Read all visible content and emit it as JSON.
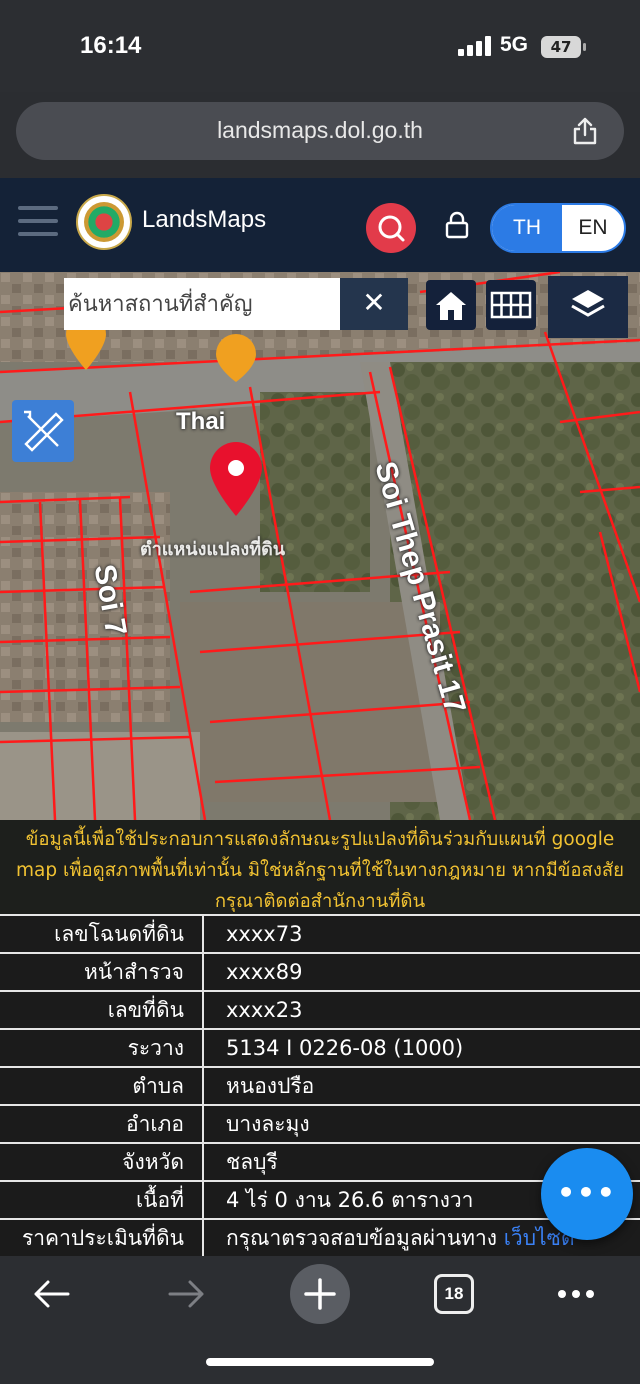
{
  "status_bar": {
    "time": "16:14",
    "network": "5G",
    "battery": "47"
  },
  "browser": {
    "url": "landsmaps.dol.go.th",
    "tab_count": "18"
  },
  "app": {
    "brand": "LandsMaps",
    "lang_th": "TH",
    "lang_en": "EN"
  },
  "map": {
    "search_placeholder": "ค้นหาสถานที่สำคัญ",
    "clear_label": "✕",
    "labels": {
      "thai": "Thai",
      "soi7": "Soi 7",
      "soi_thep": "Soi Thep Prasit 17",
      "parcel": "ตำแหน่งแปลงที่ดิน"
    }
  },
  "disclaimer": "ข้อมูลนี้เพื่อใช้ประกอบการแสดงลักษณะรูปแปลงที่ดินร่วมกับแผนที่ google map เพื่อดูสภาพพื้นที่เท่านั้น มิใช่หลักฐานที่ใช้ในทางกฎหมาย หากมีข้อสงสัย กรุณาติดต่อสำนักงานที่ดิน",
  "parcel_info": [
    {
      "label": "เลขโฉนดที่ดิน",
      "value": "xxxx73"
    },
    {
      "label": "หน้าสำรวจ",
      "value": "xxxx89"
    },
    {
      "label": "เลขที่ดิน",
      "value": "xxxx23"
    },
    {
      "label": "ระวาง",
      "value": "5134 I 0226-08 (1000)"
    },
    {
      "label": "ตำบล",
      "value": "หนองปรือ"
    },
    {
      "label": "อำเภอ",
      "value": "บางละมุง"
    },
    {
      "label": "จังหวัด",
      "value": "ชลบุรี"
    },
    {
      "label": "เนื้อที่",
      "value": "4 ไร่ 0 งาน 26.6 ตารางวา"
    },
    {
      "label": "ราคาประเมินที่ดิน",
      "value": "กรุณาตรวจสอบข้อมูลผ่านทาง ",
      "link": "เว็บไซต์"
    }
  ],
  "fab_label": "•••",
  "colors": {
    "header": "#142237",
    "accent": "#2c7be5",
    "search_red": "#e23b4a",
    "disclaimer_text": "#f1c232",
    "parcel_lines": "#ff1a1a"
  }
}
